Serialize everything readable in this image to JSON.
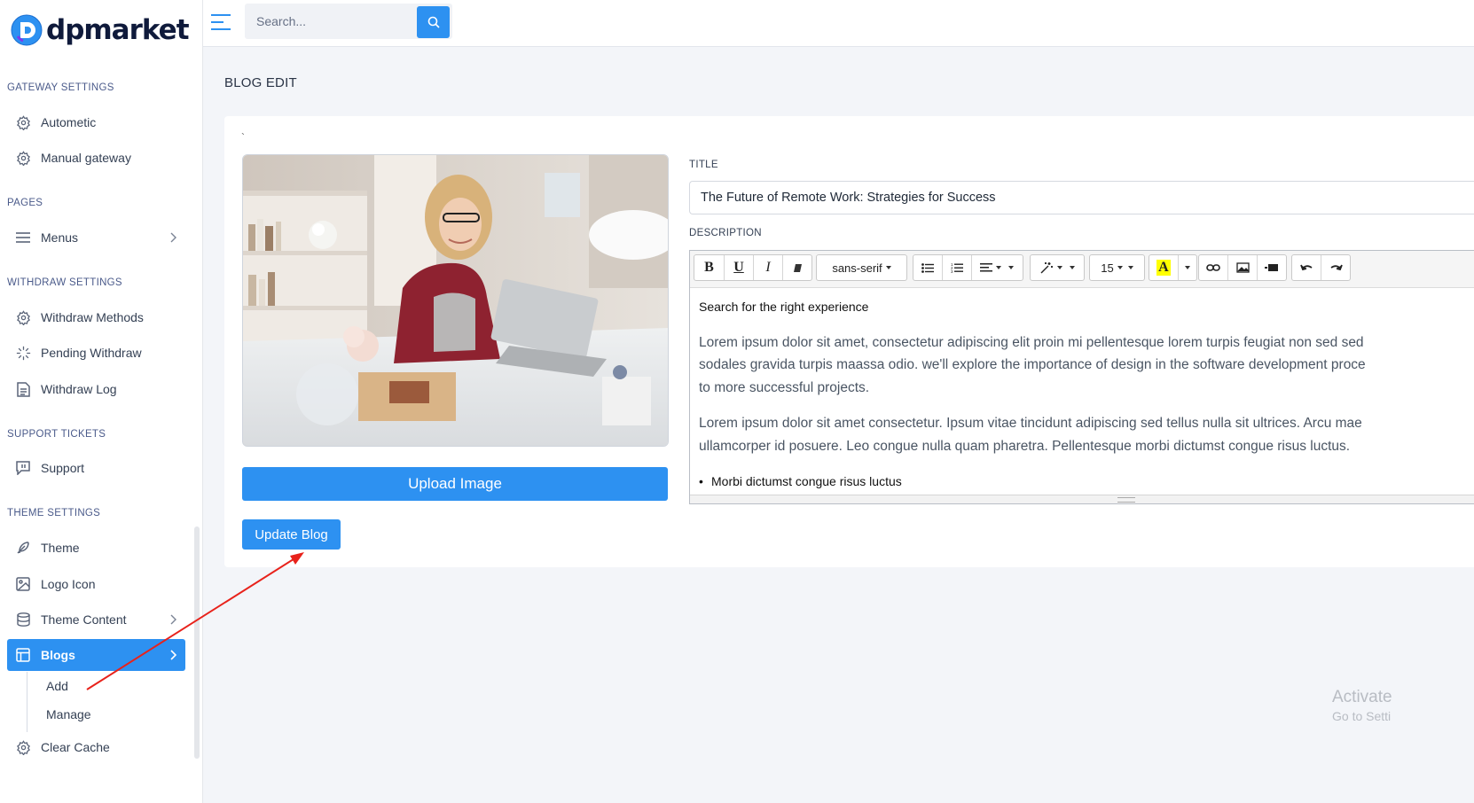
{
  "brand": {
    "name": "dpmarket"
  },
  "sidebar": {
    "sections": {
      "gateway": "GATEWAY SETTINGS",
      "pages": "PAGES",
      "withdraw": "WITHDRAW SETTINGS",
      "support": "SUPPORT TICKETS",
      "theme": "THEME SETTINGS"
    },
    "items": {
      "automatic": "Autometic",
      "manual_gateway": "Manual gateway",
      "menus": "Menus",
      "withdraw_methods": "Withdraw Methods",
      "pending_withdraw": "Pending Withdraw",
      "withdraw_log": "Withdraw Log",
      "support": "Support",
      "theme": "Theme",
      "logo_icon": "Logo Icon",
      "theme_content": "Theme Content",
      "blogs": "Blogs",
      "add": "Add",
      "manage": "Manage",
      "clear_cache": "Clear Cache"
    }
  },
  "topbar": {
    "search_placeholder": "Search..."
  },
  "page": {
    "heading": "BLOG EDIT",
    "tick_mark": "`",
    "upload_label": "Upload Image",
    "update_label": "Update Blog",
    "title_label": "TITLE",
    "title_value": "The Future of Remote Work: Strategies for Success",
    "description_label": "DESCRIPTION"
  },
  "editor": {
    "font_family": "sans-serif",
    "font_size": "15",
    "heading": "Search for the right experience",
    "para1_line1": "Lorem ipsum dolor sit amet, consectetur adipiscing elit proin mi pellentesque lorem turpis feugiat non sed sed",
    "para1_line2": "sodales gravida turpis maassa odio. we'll explore the importance of design in the software development proce",
    "para1_line3": "to more successful projects.",
    "para2_line1": "Lorem ipsum dolor sit amet consectetur. Ipsum vitae tincidunt adipiscing sed tellus nulla sit ultrices. Arcu mae",
    "para2_line2": "ullamcorper id posuere. Leo congue nulla quam pharetra. Pellentesque morbi dictumst congue risus luctus.",
    "bullet": "Morbi dictumst congue risus luctus"
  },
  "watermark": {
    "line1": "Activate",
    "line2": "Go to Setti"
  },
  "colors": {
    "accent": "#2d91f1",
    "annotation_arrow": "#e8221b"
  }
}
